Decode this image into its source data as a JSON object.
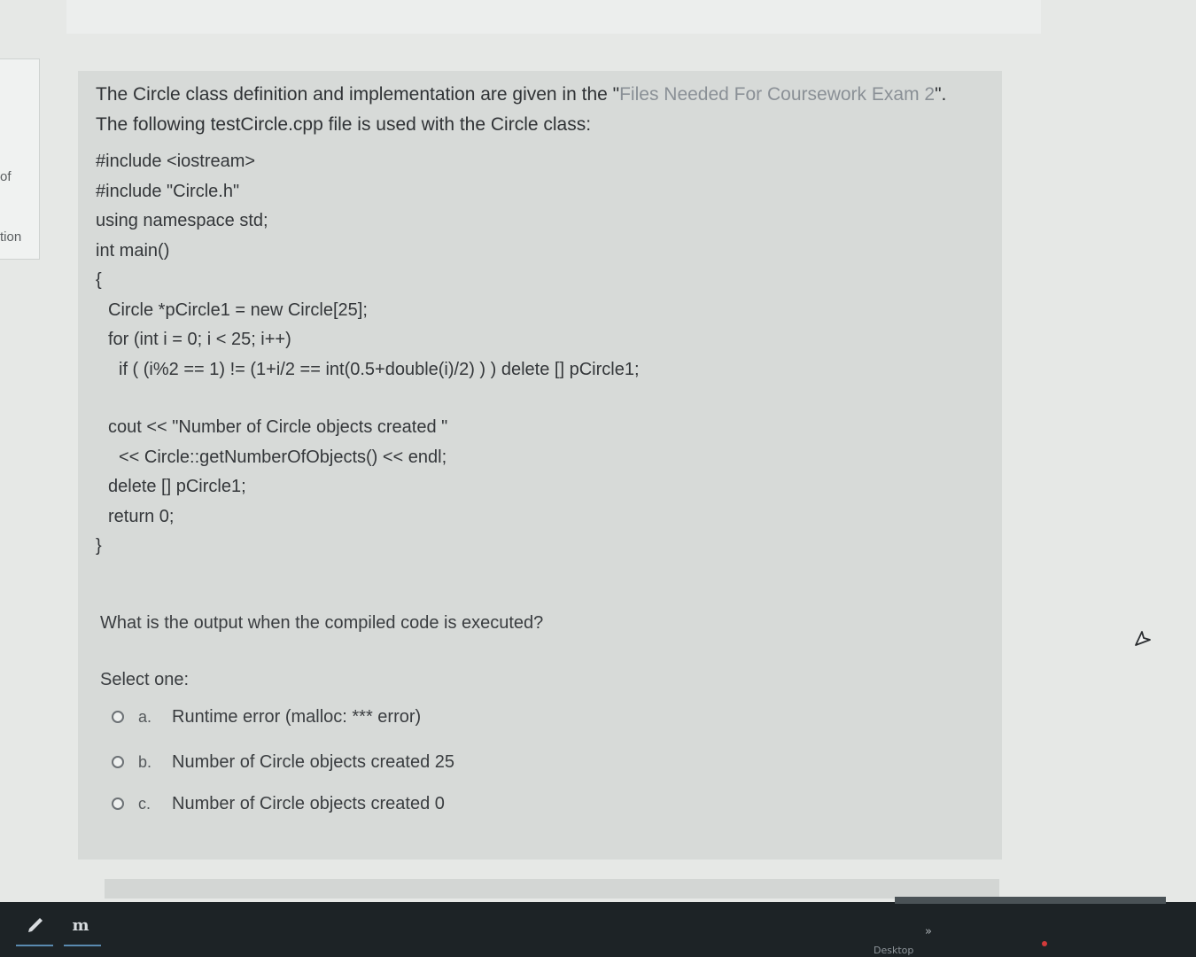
{
  "intro": {
    "line1_plain": "The Circle class definition and implementation are given in the \"",
    "line1_dim": "Files Needed For Coursework Exam 2",
    "line1_end": "\".",
    "line2": "The following testCircle.cpp file is used with the Circle class:"
  },
  "code_lines": [
    "#include <iostream>",
    "#include \"Circle.h\"",
    "using namespace std;",
    "int main()",
    "{",
    "Circle *pCircle1 = new Circle[25];",
    "for (int i = 0; i < 25; i++)",
    "if ( (i%2 == 1) != (1+i/2 == int(0.5+double(i)/2) ) ) delete [] pCircle1;",
    "cout << \"Number of Circle objects created \"",
    "<< Circle::getNumberOfObjects() << endl;",
    "delete [] pCircle1;",
    "return 0;",
    "}"
  ],
  "question": {
    "prompt": "What is the output when the compiled code is executed?",
    "select_label": "Select one:",
    "options": [
      {
        "letter": "a.",
        "text": "Runtime error (malloc: *** error)"
      },
      {
        "letter": "b.",
        "text": "Number of Circle objects created 25"
      },
      {
        "letter": "c.",
        "text": "Number of Circle objects created 0"
      }
    ]
  },
  "left_nav": {
    "fragment_1": "of",
    "fragment_2": "tion"
  },
  "taskbar": {
    "desktop_label": "Desktop",
    "chevron": "»",
    "app_icon_glyph": "m"
  },
  "icons": {
    "radio": "radio-circle-icon",
    "cursor": "mouse-pointer-icon",
    "pen": "pen-icon",
    "chevron": "double-chevron-right-icon"
  }
}
